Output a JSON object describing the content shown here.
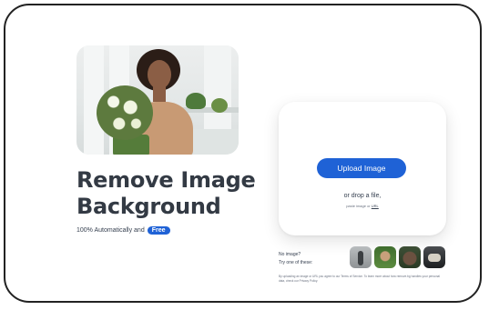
{
  "hero": {
    "headline_line1": "Remove Image",
    "headline_line2": "Background",
    "subtitle": "100% Automatically and",
    "badge": "Free"
  },
  "upload": {
    "button_label": "Upload Image",
    "drop_text": "or drop a file,",
    "paste_text": "paste image or",
    "paste_link": "URL"
  },
  "samples": {
    "line1": "No image?",
    "line2": "Try one of these:",
    "thumbs": [
      "sample-bottle",
      "sample-person-plants",
      "sample-dog",
      "sample-car"
    ]
  },
  "legal": {
    "text": "By uploading an image or URL you agree to our Terms of Service. To learn more about how remove.bg handles your personal data, check our Privacy Policy."
  },
  "colors": {
    "accent": "#1f62d6",
    "headline": "#333a44"
  }
}
